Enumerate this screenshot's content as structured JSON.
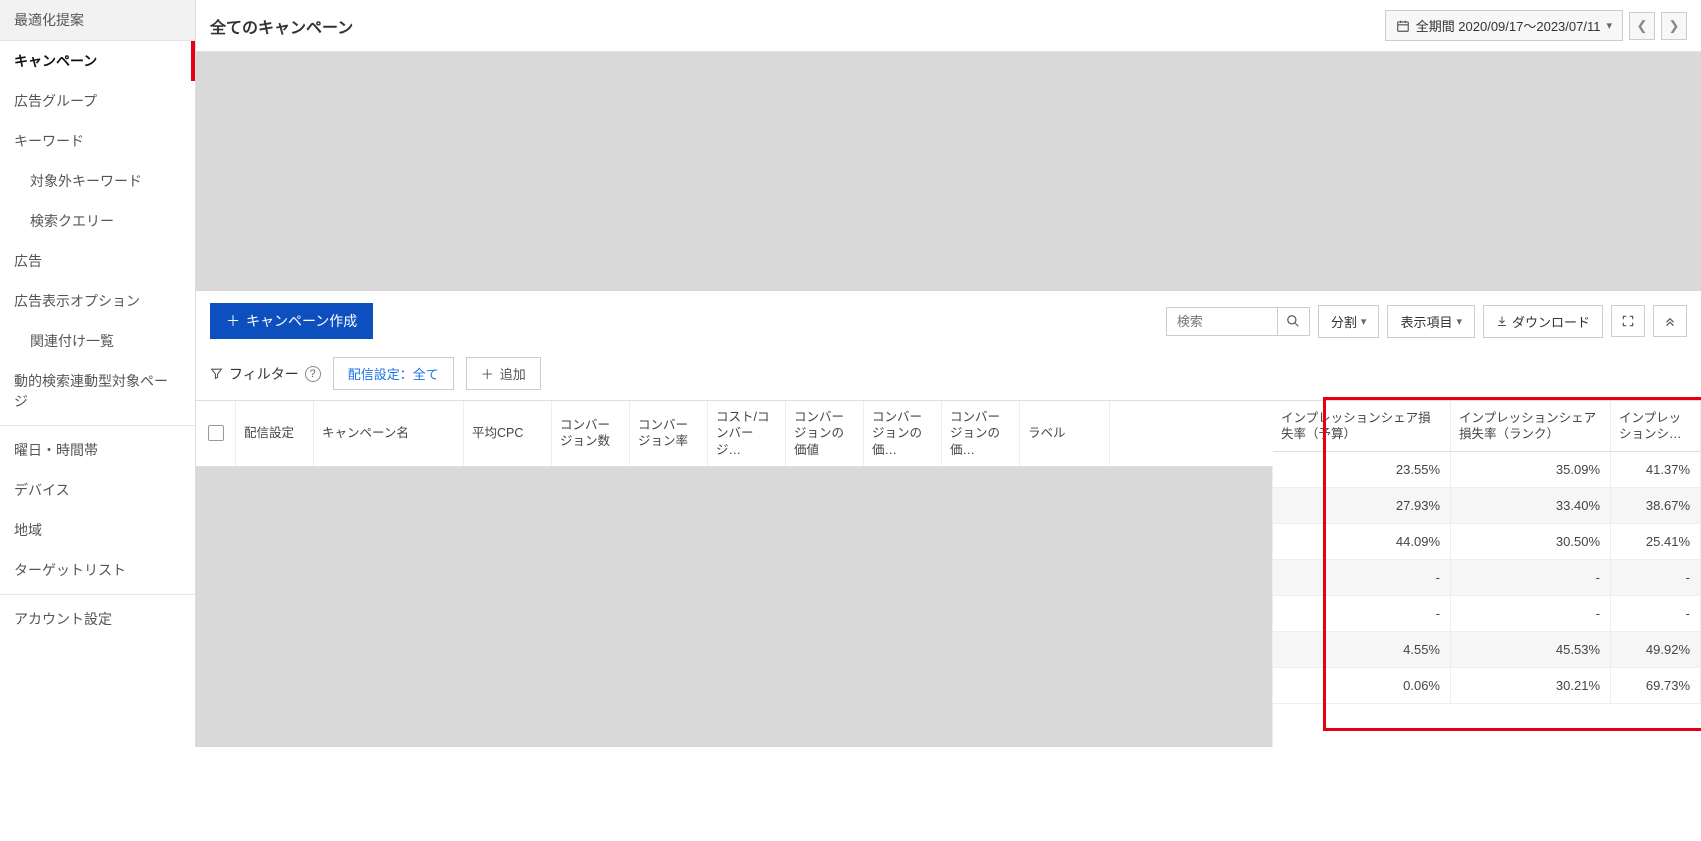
{
  "sidebar": {
    "optimize": "最適化提案",
    "campaign": "キャンペーン",
    "adgroup": "広告グループ",
    "keyword": "キーワード",
    "neg_keyword": "対象外キーワード",
    "search_query": "検索クエリー",
    "ad": "広告",
    "ad_ext": "広告表示オプション",
    "assoc_list": "関連付け一覧",
    "dsa_page": "動的検索連動型対象ページ",
    "dow": "曜日・時間帯",
    "device": "デバイス",
    "geo": "地域",
    "target_list": "ターゲットリスト",
    "account": "アカウント設定"
  },
  "header": {
    "title": "全てのキャンペーン",
    "date_label": "全期間 2020/09/17～2023/07/11"
  },
  "toolbar": {
    "create": "キャンペーン作成",
    "search_ph": "検索",
    "split": "分割",
    "columns": "表示項目",
    "download": "ダウンロード"
  },
  "filter": {
    "label": "フィルター",
    "chip": "配信設定：全て",
    "add": "追加"
  },
  "columns": {
    "delivery": "配信設定",
    "name": "キャンペーン名",
    "cpc": "平均CPC",
    "conv": "コンバージョン数",
    "convr": "コンバージョン率",
    "costc": "コスト/コンバージ…",
    "cval": "コンバージョンの価値",
    "cval2": "コンバージョンの価…",
    "cval3": "コンバージョンの価…",
    "label": "ラベル",
    "isloss_budget": "インプレッションシェア損失率（予算）",
    "isloss_rank": "インプレッションシェア損失率（ランク）",
    "impshare": "インプレッションシ…"
  },
  "rows": [
    {
      "budget": "23.55%",
      "rank": "35.09%",
      "share": "41.37%"
    },
    {
      "budget": "27.93%",
      "rank": "33.40%",
      "share": "38.67%"
    },
    {
      "budget": "44.09%",
      "rank": "30.50%",
      "share": "25.41%"
    },
    {
      "budget": "-",
      "rank": "-",
      "share": "-"
    },
    {
      "budget": "-",
      "rank": "-",
      "share": "-"
    },
    {
      "budget": "4.55%",
      "rank": "45.53%",
      "share": "49.92%"
    },
    {
      "budget": "0.06%",
      "rank": "30.21%",
      "share": "69.73%"
    }
  ]
}
